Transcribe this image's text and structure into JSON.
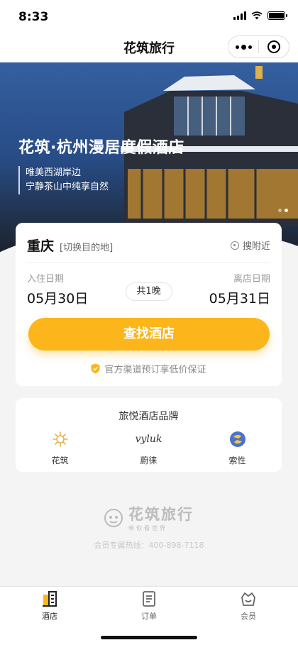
{
  "status": {
    "time": "8:33"
  },
  "nav": {
    "title": "花筑旅行"
  },
  "hero": {
    "title": "花筑·杭州漫居度假酒店",
    "subtitle_lines": [
      "唯美西湖岸边",
      "宁静茶山中纯享自然"
    ],
    "carousel_count": 2,
    "carousel_active": 1
  },
  "search": {
    "city": "重庆",
    "change_city": "[切换目的地]",
    "nearby": "搜附近",
    "checkin_label": "入住日期",
    "checkin_date": "05月30日",
    "checkout_label": "离店日期",
    "checkout_date": "05月31日",
    "nights": "共1晚",
    "button": "查找酒店",
    "guarantee": "官方渠道预订享低价保证"
  },
  "brands": {
    "title": "旅悦酒店品牌",
    "items": [
      {
        "name": "花筑",
        "icon": "huazhu-logo"
      },
      {
        "name": "蔚徕",
        "logo_text": "vyluk",
        "icon": "vyluk-logo"
      },
      {
        "name": "索性",
        "icon": "suoxing-logo"
      }
    ]
  },
  "footer": {
    "logo_text": "花筑旅行",
    "logo_sub": "带你看世界",
    "hotline": "会员专属热线：400-898-7118"
  },
  "tabbar": {
    "items": [
      {
        "label": "酒店",
        "icon": "hotel-icon",
        "active": true
      },
      {
        "label": "订单",
        "icon": "order-icon",
        "active": false
      },
      {
        "label": "会员",
        "icon": "member-icon",
        "active": false
      }
    ]
  },
  "colors": {
    "accent": "#fcb51a",
    "shield": "#fcb51a"
  }
}
